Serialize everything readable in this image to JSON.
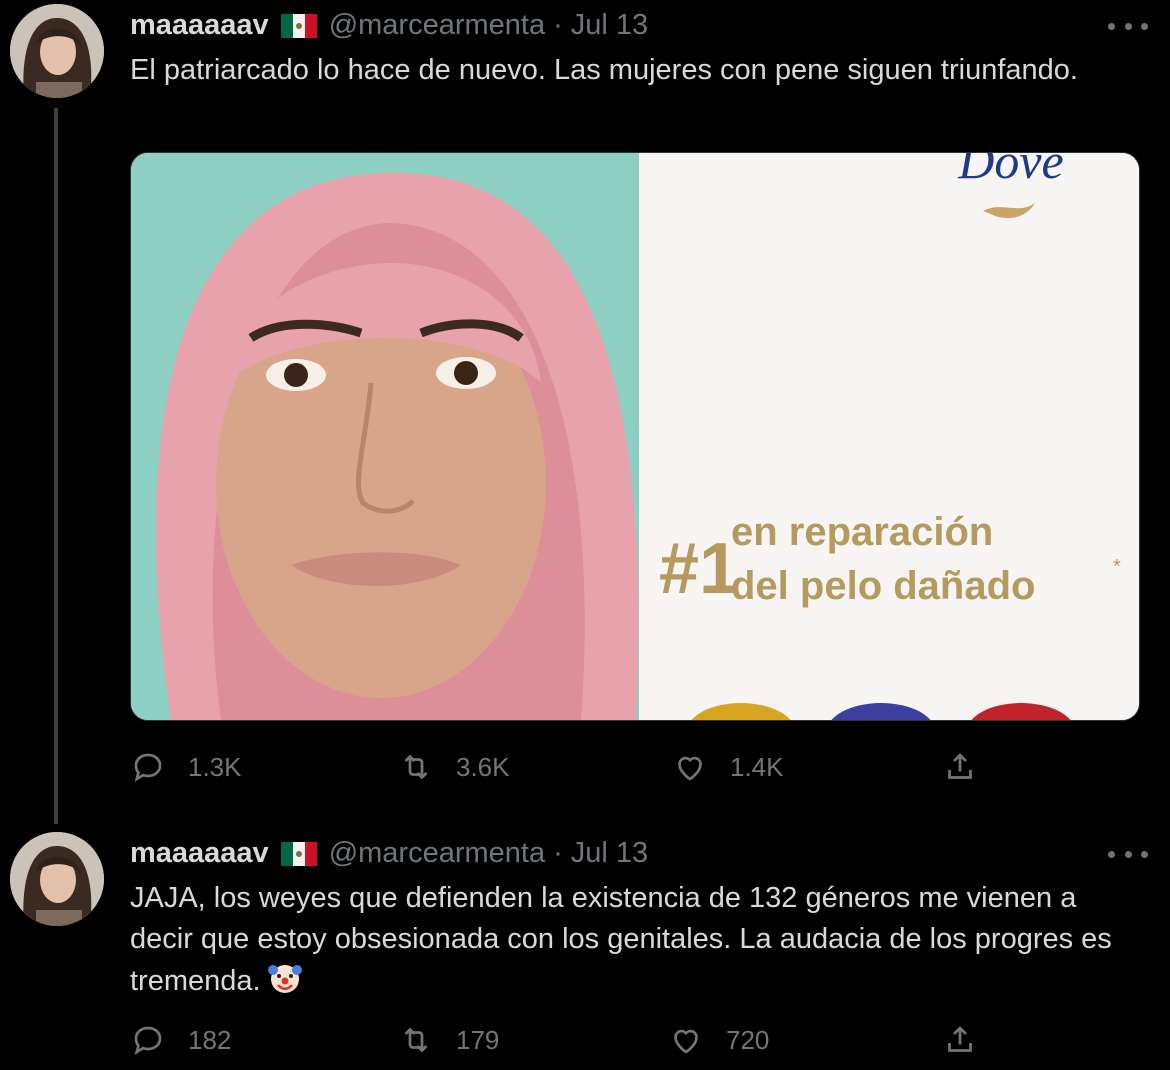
{
  "tweets": [
    {
      "display_name": "maaaaaav",
      "handle": "@marcearmenta",
      "separator": "·",
      "date": "Jul 13",
      "text": "El patriarcado lo hace de nuevo. Las mujeres con pene siguen triunfando.",
      "media": {
        "brand": "Dove",
        "rank": "#1",
        "tagline_line1": "en reparación",
        "tagline_line2": "del pelo dañado",
        "asterisk": "*"
      },
      "replies": "1.3K",
      "retweets": "3.6K",
      "likes": "1.4K"
    },
    {
      "display_name": "maaaaaav",
      "handle": "@marcearmenta",
      "separator": "·",
      "date": "Jul 13",
      "text": "JAJA, los weyes que defienden la existencia de 132 géneros me vienen a decir que estoy obsesionada con los genitales. La audacia de los progres es tremenda.",
      "emoji": "clown-face-icon",
      "replies": "182",
      "retweets": "179",
      "likes": "720"
    }
  ],
  "colors": {
    "background": "#000000",
    "text": "#d9d9d9",
    "secondary": "#71767b",
    "thread_line": "#3d4145",
    "brand_blue": "#1f3a8a",
    "gold": "#b59a5f"
  }
}
